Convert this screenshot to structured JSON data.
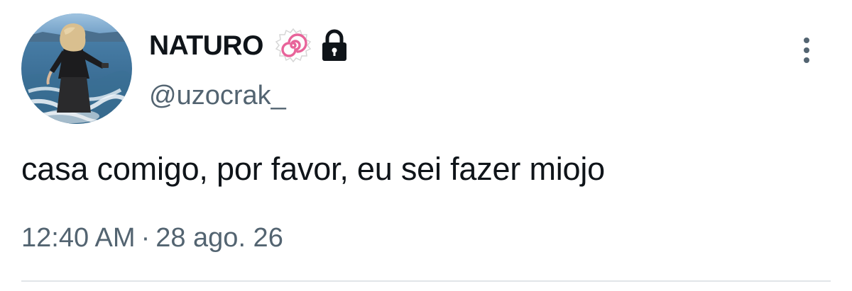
{
  "author": {
    "display_name": "NATURO",
    "handle": "@uzocrak_",
    "badges": [
      "naruto-spiral-icon",
      "lock-icon"
    ]
  },
  "tweet": {
    "text": "casa comigo, por favor, eu sei fazer miojo",
    "time": "12:40 AM",
    "separator": "·",
    "date": "28 ago. 26"
  },
  "menu": {
    "icon": "more-vertical-icon"
  },
  "colors": {
    "primary_text": "#0f1419",
    "secondary_text": "#536471",
    "divider": "#e1e5e8",
    "naruto_pink": "#e8649a"
  }
}
